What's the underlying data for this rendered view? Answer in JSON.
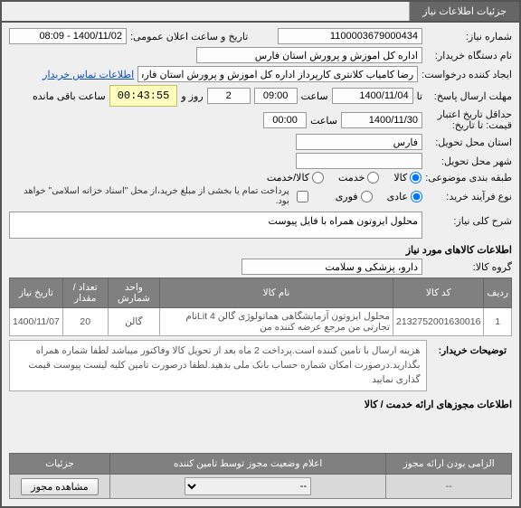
{
  "tabs": {
    "t1": "جزئیات اطلاعات نیاز"
  },
  "f": {
    "need_no_lbl": "شماره نیاز:",
    "need_no": "1100003679000434",
    "announce_lbl": "تاریخ و ساعت اعلان عمومی:",
    "announce": "1400/11/02 - 08:09",
    "buyer_org_lbl": "نام دستگاه خریدار:",
    "buyer_org": "اداره کل اموزش و پرورش استان فارس",
    "requester_lbl": "ایجاد کننده درخواست:",
    "requester": "رضا کامیاب کلانتری کارپرداز اداره کل اموزش و پرورش استان فارس",
    "contact_link": "اطلاعات تماس خریدار",
    "reply_due_lbl": "مهلت ارسال پاسخ:",
    "reply_due_to": "تا",
    "reply_date": "1400/11/04",
    "time_lbl": "ساعت",
    "reply_time": "09:00",
    "days_lbl": "روز و",
    "days": "2",
    "timer": "00:43:55",
    "remain_lbl": "ساعت باقی مانده",
    "valid_lbl": "حداقل تاریخ اعتبار",
    "valid_lbl2": "قیمت: تا تاریخ:",
    "valid_date": "1400/11/30",
    "valid_time": "00:00",
    "del_prov_lbl": "استان محل تحویل:",
    "del_prov": "فارس",
    "del_city_lbl": "شهر محل تحویل:",
    "subject_lbl": "طبقه بندی موضوعی:",
    "subject_goods": "کالا",
    "subject_service": "خدمت",
    "subject_both": "کالا/خدمت",
    "process_lbl": "نوع فرآیند خرید:",
    "process_normal": "عادی",
    "process_urgent": "فوری",
    "pay_note": "پرداخت تمام یا بخشی از مبلغ خرید،از محل \"اسناد خزانه اسلامی\" خواهد بود.",
    "need_desc_lbl": "شرح کلی نیاز:",
    "need_desc": "محلول ایزوتون همراه با فایل پیوست",
    "items_hdr": "اطلاعات کالاهای مورد نیاز",
    "group_lbl": "گروه کالا:",
    "group": "دارو، پزشکی و سلامت",
    "th_row": "ردیف",
    "th_code": "کد کالا",
    "th_name": "نام کالا",
    "th_unit": "واحد شمارش",
    "th_qty": "تعداد / مقدار",
    "th_date": "تاریخ نیاز",
    "r1_idx": "1",
    "r1_code": "2132752001630016",
    "r1_name": "محلول ایزوتون آزمایشگاهی هماتولوژی گالن 4 Litنام تجارتی من مرجع عرضه کننده من",
    "r1_unit": "گالن",
    "r1_qty": "20",
    "r1_date": "1400/11/07",
    "buyer_notes_lbl": "توضیحات خریدار:",
    "buyer_notes": "هزینه ارسال با تامین کننده است.پرداخت 2 ماه بعد از تحویل کالا وفاکتور میباشد لطفا شماره همراه بگذارید.درصورت امکان شماره حساب بانک ملی بدهید.لطفا درصورت تامین کلیه لیست پیوست قیمت گذاری نمایید",
    "lic_hdr": "اطلاعات مجوزهای ارائه خدمت / کالا",
    "bth_mandatory": "الزامی بودن ارائه مجوز",
    "bth_status": "اعلام وضعیت مجوز توسط تامین کننده",
    "bth_details": "جزئیات",
    "sel_dash": "--",
    "btn_view": "مشاهده مجوز"
  }
}
